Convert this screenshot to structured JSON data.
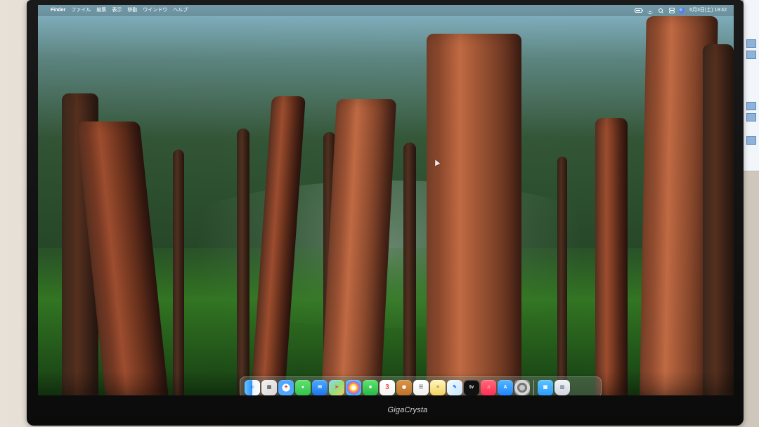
{
  "menubar": {
    "items": [
      "Finder",
      "ファイル",
      "編集",
      "表示",
      "移動",
      "ウインドウ",
      "ヘルプ"
    ],
    "datetime": "6月3日(土) 19:42"
  },
  "dock": {
    "items": [
      {
        "name": "Finder",
        "icon": "finder-icon"
      },
      {
        "name": "Launchpad",
        "icon": "launchpad-icon"
      },
      {
        "name": "Safari",
        "icon": "safari-icon"
      },
      {
        "name": "Messages",
        "icon": "messages-icon"
      },
      {
        "name": "Mail",
        "icon": "mail-icon"
      },
      {
        "name": "Maps",
        "icon": "maps-icon"
      },
      {
        "name": "Photos",
        "icon": "photos-icon"
      },
      {
        "name": "FaceTime",
        "icon": "facetime-icon"
      },
      {
        "name": "Calendar",
        "icon": "calendar-icon",
        "badge": "3"
      },
      {
        "name": "Contacts",
        "icon": "contacts-icon"
      },
      {
        "name": "Reminders",
        "icon": "reminders-icon"
      },
      {
        "name": "Notes",
        "icon": "notes-icon"
      },
      {
        "name": "Freeform",
        "icon": "freeform-icon"
      },
      {
        "name": "TV",
        "icon": "tv-icon",
        "label": "tv"
      },
      {
        "name": "Music",
        "icon": "music-icon"
      },
      {
        "name": "App Store",
        "icon": "app-store-icon"
      },
      {
        "name": "System Settings",
        "icon": "system-settings-icon"
      },
      {
        "name": "Downloads",
        "icon": "downloads-folder-icon"
      },
      {
        "name": "Trash",
        "icon": "trash-icon"
      }
    ]
  },
  "monitor": {
    "brand": "GigaCrysta"
  },
  "colors": {
    "dock_background": "#7e917e",
    "menubar_text": "#ffffff",
    "brand_text": "#d8d8d8"
  }
}
